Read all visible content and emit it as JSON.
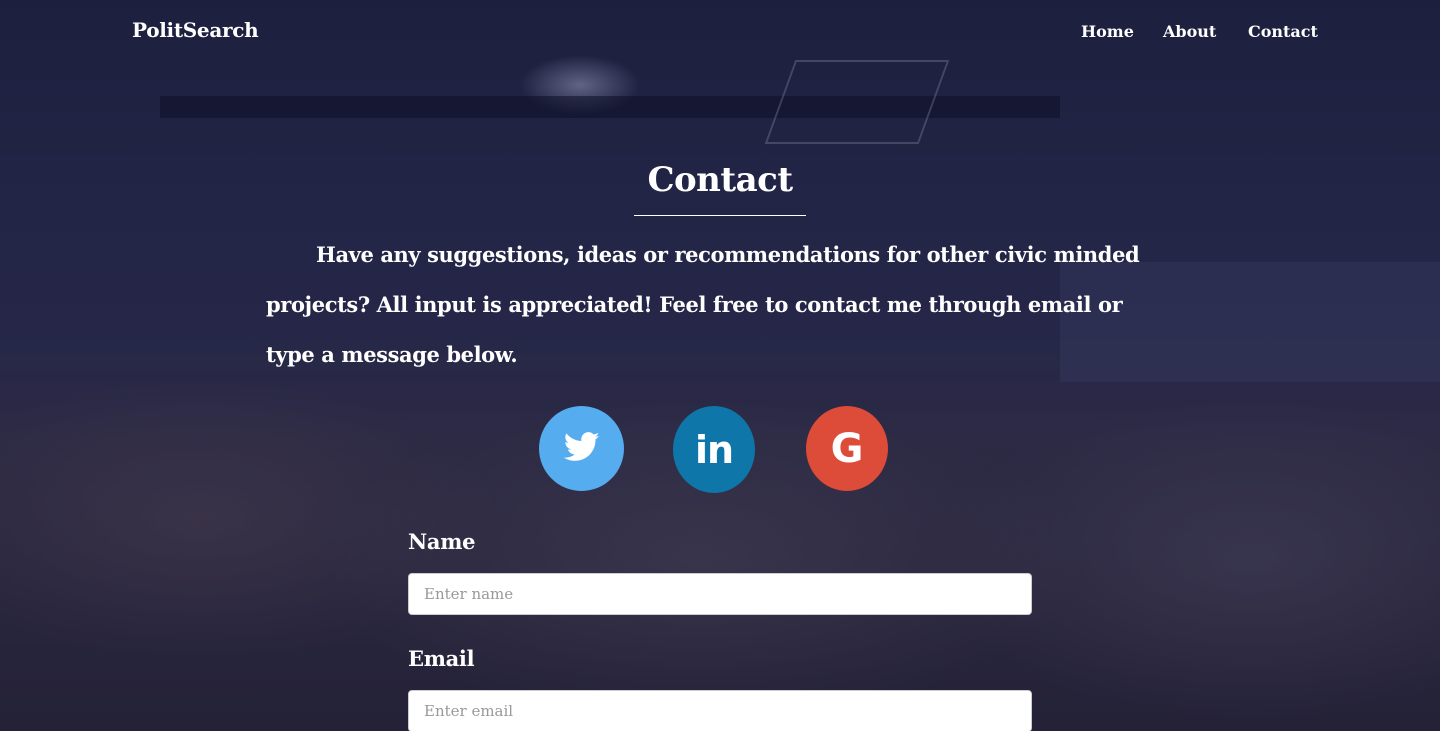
{
  "navbar": {
    "brand": "PolitSearch",
    "links": [
      "Home",
      "About",
      "Contact"
    ]
  },
  "contact": {
    "title": "Contact",
    "intro": "Have any suggestions, ideas or recommendations for other civic minded projects? All input is appreciated! Feel free to contact me through email or type a message below."
  },
  "social": [
    {
      "name": "twitter",
      "icon": "twitter-icon",
      "color": "#55acee"
    },
    {
      "name": "linkedin",
      "icon": "linkedin-icon",
      "glyph": "in",
      "color": "#0e76a8"
    },
    {
      "name": "google",
      "icon": "google-icon",
      "glyph": "G",
      "color": "#dd4b39"
    }
  ],
  "form": {
    "name_label": "Name",
    "name_placeholder": "Enter name",
    "email_label": "Email",
    "email_placeholder": "Enter email"
  }
}
